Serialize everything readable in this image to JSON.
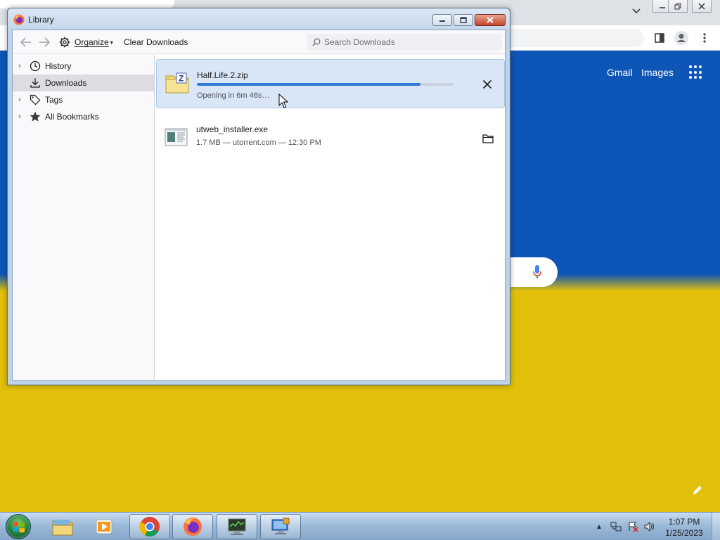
{
  "background_browser": {
    "google_links": {
      "gmail": "Gmail",
      "images": "Images"
    },
    "flag_colors": {
      "blue": "#0d55b6",
      "yellow": "#e1bf0a"
    },
    "icons": [
      "chevron-down-icon",
      "sidebar-icon",
      "profile-icon",
      "menu-dots-icon",
      "apps-grid-icon",
      "mic-icon",
      "pencil-icon"
    ]
  },
  "library": {
    "title": "Library",
    "toolbar": {
      "organize_label": "Organize",
      "clear_label": "Clear Downloads",
      "search_placeholder": "Search Downloads"
    },
    "sidebar": {
      "items": [
        {
          "label": "History",
          "icon": "clock-icon",
          "expandable": true,
          "selected": false
        },
        {
          "label": "Downloads",
          "icon": "download-icon",
          "expandable": false,
          "selected": true
        },
        {
          "label": "Tags",
          "icon": "tag-icon",
          "expandable": true,
          "selected": false
        },
        {
          "label": "All Bookmarks",
          "icon": "star-icon",
          "expandable": true,
          "selected": false
        }
      ]
    },
    "downloads": [
      {
        "name": "Half.Life.2.zip",
        "status": "Opening in 6m 46s…",
        "progress": 0.87,
        "action_icon": "cancel-icon",
        "selected": true
      },
      {
        "name": "utweb_installer.exe",
        "status": "1.7 MB — utorrent.com — 12:30 PM",
        "action_icon": "folder-icon",
        "selected": false
      }
    ]
  },
  "taskbar": {
    "apps": [
      "windows-explorer-icon",
      "media-player-icon",
      "chrome-icon",
      "firefox-icon",
      "system-monitor-icon",
      "remote-desktop-icon"
    ],
    "clock": {
      "time": "1:07 PM",
      "date": "1/25/2023"
    }
  }
}
